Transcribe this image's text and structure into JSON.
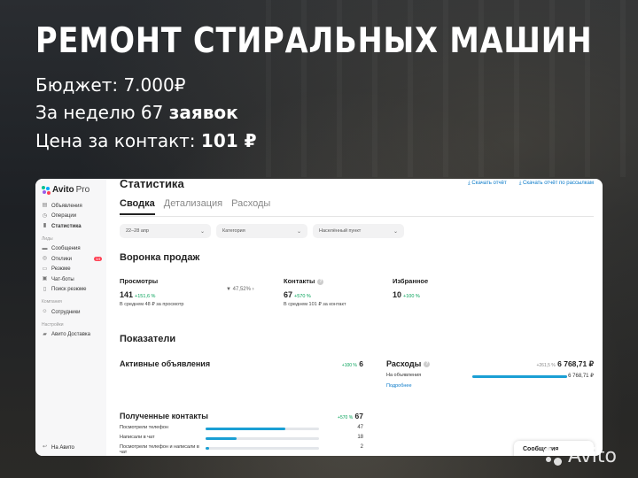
{
  "overlay": {
    "headline": "РЕМОНТ СТИРАЛЬНЫХ МАШИН",
    "budget": "Бюджет: 7.000₽",
    "week_prefix": "За неделю 67 ",
    "week_bold": "заявок",
    "price_prefix": "Цена за контакт: ",
    "price_bold": "101 ₽"
  },
  "sidebar": {
    "logo_text": "Avito",
    "logo_suffix": "Pro",
    "items_top": [
      {
        "icon": "listings-icon",
        "glyph": "▤",
        "label": "Объявления"
      },
      {
        "icon": "operations-icon",
        "glyph": "◷",
        "label": "Операции"
      },
      {
        "icon": "stats-icon",
        "glyph": "▮",
        "label": "Статистика",
        "active": true
      }
    ],
    "section_leads": "Лиды",
    "items_leads": [
      {
        "icon": "messages-icon",
        "glyph": "▬",
        "label": "Сообщения"
      },
      {
        "icon": "responses-icon",
        "glyph": "◎",
        "label": "Отклики",
        "badge": "14"
      },
      {
        "icon": "resume-icon",
        "glyph": "▭",
        "label": "Резюме"
      },
      {
        "icon": "chatbot-icon",
        "glyph": "▣",
        "label": "Чат-боты"
      },
      {
        "icon": "resume-search-icon",
        "glyph": "▯",
        "label": "Поиск резюме"
      }
    ],
    "section_company": "Компания",
    "items_company": [
      {
        "icon": "employees-icon",
        "glyph": "☺",
        "label": "Сотрудники"
      }
    ],
    "section_settings": "Настройки",
    "items_settings": [
      {
        "icon": "delivery-icon",
        "glyph": "▰",
        "label": "Авито Доставка"
      }
    ],
    "back_label": "На Авито"
  },
  "main": {
    "title": "Статистика",
    "download_report": "Скачать отчёт",
    "download_mailing": "Скачать отчёт по рассылкам",
    "tabs": [
      {
        "label": "Сводка",
        "active": true
      },
      {
        "label": "Детализация"
      },
      {
        "label": "Расходы"
      }
    ],
    "filters": {
      "period": "22–28 апр",
      "category": "Категория",
      "location": "Населённый пункт"
    },
    "funnel": {
      "title": "Воронка продаж",
      "views_label": "Просмотры",
      "views_value": "141",
      "views_pct": "+151,6 %",
      "views_note": "В среднем 48 ₽ за просмотр",
      "conversion": "47,52%",
      "contacts_label": "Контакты",
      "contacts_value": "67",
      "contacts_pct": "+570 %",
      "contacts_note": "В среднем 101 ₽ за контакт",
      "fav_label": "Избранное",
      "fav_value": "10",
      "fav_pct": "+100 %"
    },
    "indicators": {
      "title": "Показатели",
      "active_ads_label": "Активные объявления",
      "active_ads_pct": "+100 %",
      "active_ads_value": "6",
      "expenses_label": "Расходы",
      "expenses_pct": "+261,5 %",
      "expenses_value": "6 768,71 ₽",
      "expenses_row_label": "На объявления",
      "expenses_row_value": "6 768,71 ₽",
      "expenses_row_share": 1.0,
      "details_link": "Подробнее",
      "contacts_label": "Полученные контакты",
      "contacts_pct": "+570 %",
      "contacts_value": "67",
      "rows": [
        {
          "label": "Посмотрели телефон",
          "value": "47",
          "share": 0.7
        },
        {
          "label": "Написали в чат",
          "value": "18",
          "share": 0.27
        },
        {
          "label": "Посмотрели телефон и написали в чат",
          "value": "2",
          "share": 0.03
        }
      ]
    },
    "messages_button": "Сообщения"
  },
  "watermark": "Avito"
}
